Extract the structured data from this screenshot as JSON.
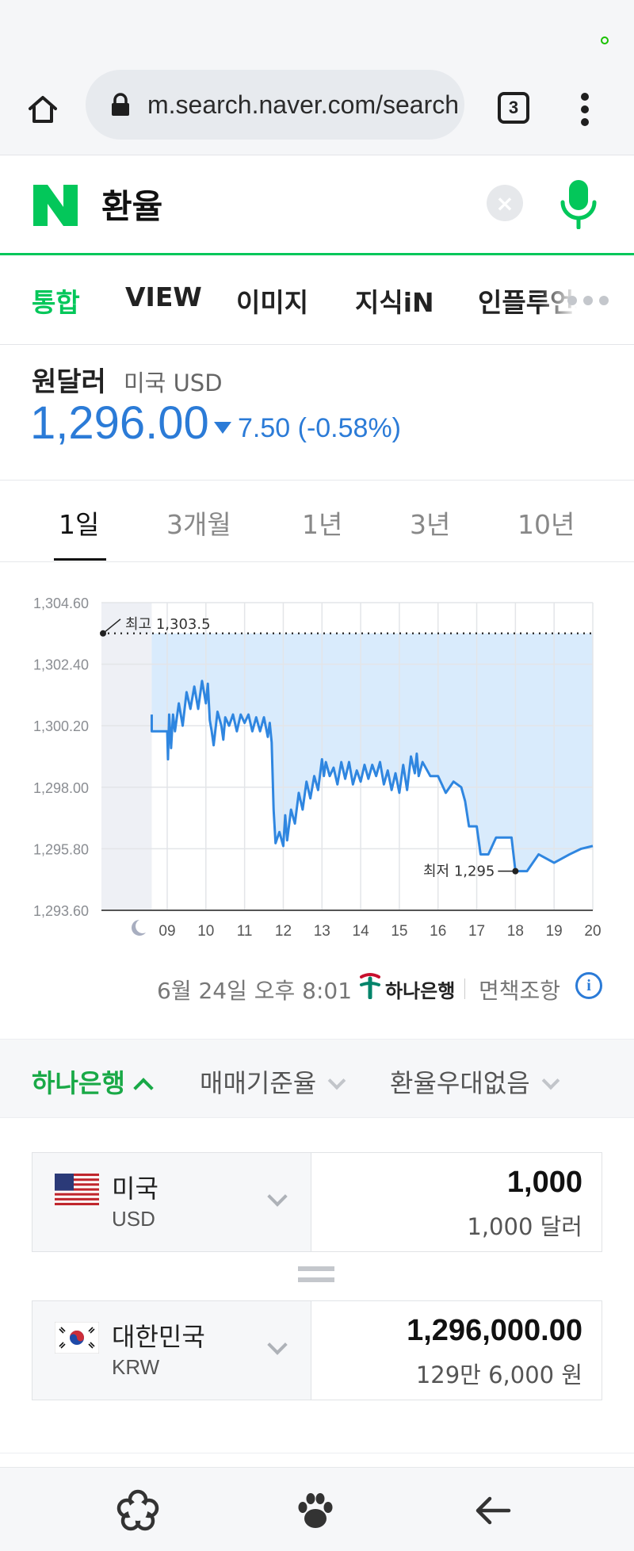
{
  "browser": {
    "url": "m.search.naver.com/search",
    "tab_count": "3",
    "icons": {
      "home": "home-icon",
      "lock": "lock-icon",
      "menu": "more-vertical-icon"
    }
  },
  "search": {
    "query": "환율",
    "clear_symbol": "×",
    "logo": "N"
  },
  "categories": [
    {
      "label": "통합",
      "active": true
    },
    {
      "label": "VIEW",
      "active": false
    },
    {
      "label": "이미지",
      "active": false
    },
    {
      "label": "지식iN",
      "active": false
    },
    {
      "label": "인플루언서",
      "active": false
    }
  ],
  "rate": {
    "name": "원달러",
    "sub": "미국 USD",
    "value": "1,296.00",
    "change": "7.50 (-0.58%)",
    "direction": "down"
  },
  "periods": [
    {
      "label": "1일",
      "active": true
    },
    {
      "label": "3개월",
      "active": false
    },
    {
      "label": "1년",
      "active": false
    },
    {
      "label": "3년",
      "active": false
    },
    {
      "label": "10년",
      "active": false
    }
  ],
  "colors": {
    "naver_green": "#03c75a",
    "rate_blue": "#2b7bd7",
    "hana_green": "#19a947",
    "chart_fill": "#d9ebfc",
    "chart_line": "#2f86e0"
  },
  "chart_data": {
    "type": "line",
    "title": "",
    "xlabel": "",
    "ylabel": "",
    "y_ticks": [
      "1,304.60",
      "1,302.40",
      "1,300.20",
      "1,298.00",
      "1,295.80",
      "1,293.60"
    ],
    "ylim": [
      1293.6,
      1304.6
    ],
    "x_ticks": [
      "09",
      "10",
      "11",
      "12",
      "13",
      "14",
      "15",
      "16",
      "17",
      "18",
      "19",
      "20"
    ],
    "xlim": [
      7.3,
      20
    ],
    "high_label": "최고 1,303.5",
    "high_value": 1303.5,
    "low_label": "최저 1,295",
    "low_value": 1295.0,
    "low_x": 18.0,
    "night_icon": "moon-icon",
    "grid": true,
    "series": [
      {
        "x": [
          8.6,
          8.6,
          8.65,
          9.0,
          9.02,
          9.05,
          9.1,
          9.15,
          9.2,
          9.3,
          9.4,
          9.5,
          9.6,
          9.7,
          9.8,
          9.9,
          10.0,
          10.05,
          10.1,
          10.15,
          10.2,
          10.3,
          10.4,
          10.45,
          10.5,
          10.6,
          10.7,
          10.8,
          10.9,
          11.0,
          11.1,
          11.2,
          11.3,
          11.4,
          11.5,
          11.6,
          11.65,
          11.7,
          11.75,
          11.8,
          11.9,
          12.0,
          12.05,
          12.1,
          12.2,
          12.3,
          12.4,
          12.5,
          12.6,
          12.7,
          12.8,
          12.9,
          13.0,
          13.05,
          13.1,
          13.2,
          13.3,
          13.4,
          13.5,
          13.6,
          13.7,
          13.8,
          13.9,
          14.0,
          14.1,
          14.2,
          14.3,
          14.4,
          14.5,
          14.6,
          14.7,
          14.8,
          14.9,
          15.0,
          15.1,
          15.2,
          15.3,
          15.4,
          15.45,
          15.5,
          15.6,
          15.8,
          16.0,
          16.2,
          16.4,
          16.6,
          16.7,
          16.8,
          17.0,
          17.1,
          17.3,
          17.5,
          17.7,
          17.9,
          18.0,
          18.3,
          18.6,
          19.0,
          19.4,
          19.7,
          20.0
        ],
        "y": [
          1300.6,
          1300.0,
          1300.0,
          1300.0,
          1299.0,
          1300.6,
          1299.4,
          1300.6,
          1300.0,
          1301.0,
          1300.2,
          1301.4,
          1300.8,
          1301.6,
          1300.8,
          1301.8,
          1301.0,
          1301.7,
          1300.4,
          1300.0,
          1299.5,
          1300.7,
          1300.2,
          1299.7,
          1300.5,
          1300.2,
          1300.6,
          1300.0,
          1300.6,
          1300.3,
          1300.6,
          1300.0,
          1300.5,
          1300.0,
          1300.5,
          1299.8,
          1300.3,
          1299.6,
          1297.2,
          1296.0,
          1296.4,
          1295.9,
          1297.0,
          1296.1,
          1297.2,
          1296.7,
          1297.8,
          1297.2,
          1298.2,
          1297.6,
          1298.4,
          1297.9,
          1299.0,
          1298.4,
          1298.9,
          1298.4,
          1298.7,
          1298.1,
          1298.9,
          1298.3,
          1298.9,
          1298.1,
          1298.6,
          1298.2,
          1298.8,
          1298.3,
          1298.8,
          1298.4,
          1298.9,
          1298.1,
          1298.6,
          1297.9,
          1298.5,
          1297.8,
          1298.8,
          1297.9,
          1299.1,
          1298.5,
          1299.2,
          1298.4,
          1298.9,
          1298.4,
          1298.4,
          1297.8,
          1298.2,
          1298.0,
          1297.5,
          1296.6,
          1296.6,
          1295.6,
          1295.6,
          1296.2,
          1296.2,
          1296.2,
          1295.0,
          1295.0,
          1295.6,
          1295.3,
          1295.6,
          1295.8,
          1295.9
        ]
      }
    ]
  },
  "source": {
    "timestamp": "6월 24일 오후 8:01",
    "bank_name": "하나은행",
    "disclaimer": "면책조항",
    "info_symbol": "i"
  },
  "bank_bar": {
    "bank": "하나은행",
    "rate_type": "매매기준율",
    "discount": "환율우대없음"
  },
  "converter": {
    "from": {
      "name": "미국",
      "code": "USD",
      "amount": "1,000",
      "amount_text": "1,000 달러"
    },
    "to": {
      "name": "대한민국",
      "code": "KRW",
      "amount": "1,296,000.00",
      "amount_text": "129만 6,000 원"
    }
  },
  "bottom_nav": {
    "icons": [
      "flower-icon",
      "paw-icon",
      "back-arrow-icon"
    ]
  }
}
